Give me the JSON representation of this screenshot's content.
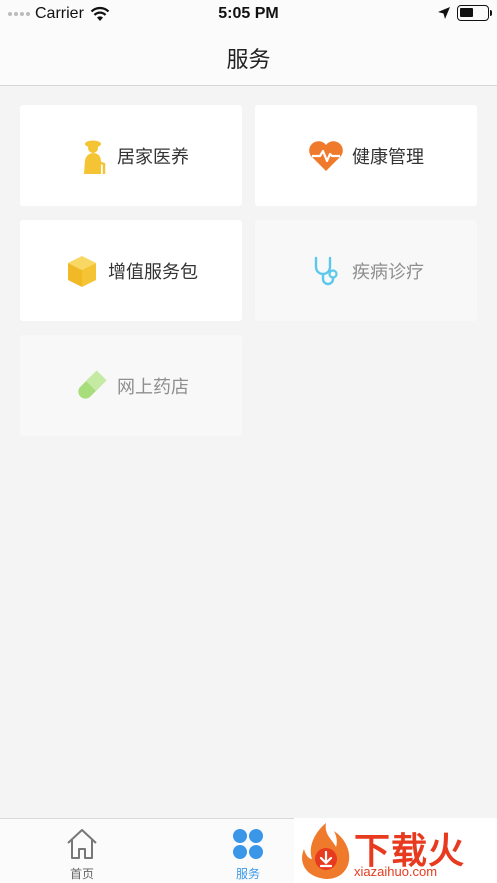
{
  "status_bar": {
    "carrier": "Carrier",
    "time": "5:05 PM"
  },
  "nav": {
    "title": "服务"
  },
  "tiles": [
    {
      "label": "居家医养",
      "icon": "elderly-person-icon",
      "color": "#f5c434",
      "enabled": true
    },
    {
      "label": "健康管理",
      "icon": "heart-pulse-icon",
      "color": "#f07a2b",
      "enabled": true
    },
    {
      "label": "增值服务包",
      "icon": "package-box-icon",
      "color": "#f5c434",
      "enabled": true
    },
    {
      "label": "疾病诊疗",
      "icon": "stethoscope-icon",
      "color": "#5bc8ec",
      "enabled": false
    },
    {
      "label": "网上药店",
      "icon": "pill-icon",
      "color": "#a8dd7c",
      "enabled": false
    }
  ],
  "tab_bar": {
    "tabs": [
      {
        "label": "首页",
        "icon": "home-icon",
        "active": false
      },
      {
        "label": "服务",
        "icon": "four-petal-grid-icon",
        "active": true
      }
    ],
    "active_color": "#3a97e8"
  },
  "watermark": {
    "text": "下载火",
    "url": "xiazaihuo.com",
    "color": "#e83a1f"
  }
}
